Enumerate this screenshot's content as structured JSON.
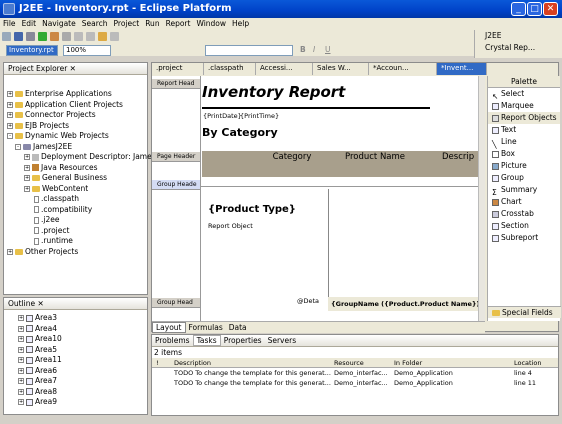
{
  "window": {
    "title": "J2EE - Inventory.rpt - Eclipse Platform",
    "min": "_",
    "max": "□",
    "close": "✕"
  },
  "menu": [
    "File",
    "Edit",
    "Navigate",
    "Search",
    "Project",
    "Run",
    "Report",
    "Window",
    "Help"
  ],
  "toolbar": {
    "file_select": "Inventory.rpt",
    "zoom": "100%",
    "perspective1": "J2EE",
    "perspective2": "Crystal Rep..."
  },
  "project_explorer": {
    "title": "Project Explorer",
    "items": [
      "Enterprise Applications",
      "Application Client Projects",
      "Connector Projects",
      "EJB Projects",
      "Dynamic Web Projects",
      "JamesJ2EE",
      "Deployment Descriptor: JamesJ",
      "Java Resources",
      "General Business",
      "WebContent",
      ".classpath",
      ".compatibility",
      ".j2ee",
      ".project",
      ".runtime",
      "Other Projects"
    ]
  },
  "outline": {
    "title": "Outline",
    "items": [
      "Area3",
      "Area4",
      "Area10",
      "Area5",
      "Area11",
      "Area6",
      "Area7",
      "Area8",
      "Area9"
    ]
  },
  "editor_tabs": [
    ".project",
    ".classpath",
    "Accessi...",
    "Sales W...",
    "*Accoun...",
    "*Invent..."
  ],
  "report": {
    "bands": {
      "report_header": "Report Head",
      "page_header": "Page Header",
      "group_header": "Group Heade",
      "group_header2": "Group Head"
    },
    "title": "Inventory Report",
    "print_date": "{PrintDate}",
    "print_time": "{PrintTime}",
    "subtitle": "By Category",
    "columns": [
      "Category",
      "Product Name",
      "Descrip"
    ],
    "group_field": "{Product Type}",
    "subreport": "Report Object",
    "deta": "@Deta",
    "group_name": "{GroupName ({Product.Product Name})}"
  },
  "editor_bottom_tabs": [
    "Layout",
    "Formulas",
    "Data"
  ],
  "palette": {
    "title": "Palette",
    "items": [
      "Select",
      "Marquee",
      "Report Objects",
      "Text",
      "Line",
      "Box",
      "Picture",
      "Group",
      "Summary",
      "Chart",
      "Crosstab",
      "Section",
      "Subreport"
    ],
    "footer": "Special Fields"
  },
  "tasks": {
    "tabs": [
      "Problems",
      "Tasks",
      "Properties",
      "Servers"
    ],
    "count": "2 items",
    "headers": [
      "!",
      "Description",
      "Resource",
      "In Folder",
      "Location"
    ],
    "rows": [
      {
        "desc": "TODO To change the template for this generat...",
        "resource": "Demo_interfac...",
        "folder": "Demo_Application",
        "location": "line 4"
      },
      {
        "desc": "TODO To change the template for this generat...",
        "resource": "Demo_interfac...",
        "folder": "Demo_Application",
        "location": "line 11"
      }
    ]
  }
}
